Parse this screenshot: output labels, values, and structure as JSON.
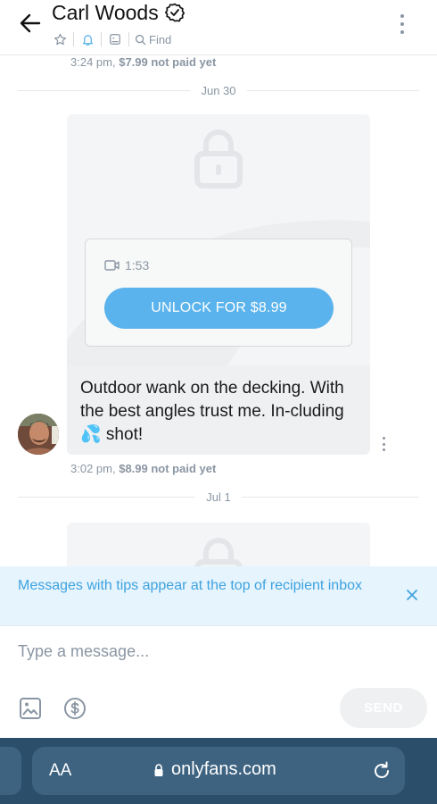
{
  "header": {
    "title": "Carl Woods",
    "find_label": "Find"
  },
  "messages": {
    "prev_meta_time": "3:24 pm,",
    "prev_meta_price": "$7.99 not paid yet",
    "date_divider_1": "Jun 30",
    "video_duration": "1:53",
    "unlock_label": "UNLOCK FOR $8.99",
    "message_text": "Outdoor wank on the decking. With the best angles trust me. In-cluding 💦 shot!",
    "meta_time": "3:02 pm,",
    "meta_price": "$8.99 not paid yet",
    "date_divider_2": "Jul 1"
  },
  "tip_banner": {
    "text": "Messages with tips appear at the top of recipient inbox"
  },
  "composer": {
    "placeholder": "Type a message...",
    "send_label": "SEND"
  },
  "browser": {
    "aa_label": "AA",
    "url": "onlyfans.com"
  },
  "colors": {
    "accent": "#5ab3ec",
    "tip_text": "#3ea2df",
    "tip_bg": "#e6f4fd",
    "muted": "#8a96a3",
    "browser_bg": "#2b4f6b"
  }
}
